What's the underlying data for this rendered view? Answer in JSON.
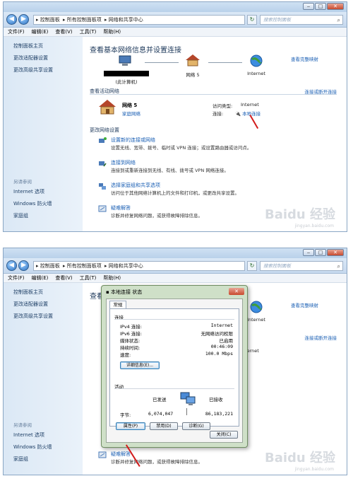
{
  "window": {
    "caption": {
      "minimize": "‒",
      "maximize": "□",
      "close": "✕"
    },
    "nav": {
      "back": "◀",
      "forward": "▶"
    },
    "breadcrumb": [
      "控制面板",
      "所有控制面板项",
      "网络和共享中心"
    ],
    "search_placeholder": "搜索控制面板",
    "menu": [
      "文件(F)",
      "编辑(E)",
      "查看(V)",
      "工具(T)",
      "帮助(H)"
    ]
  },
  "sidebar": {
    "items": [
      "控制面板主页",
      "更改适配器设置",
      "更改高级共享设置"
    ],
    "see_also_label": "另请参阅",
    "see_also": [
      "Internet 选项",
      "Windows 防火墙",
      "家庭组"
    ]
  },
  "main": {
    "title": "查看基本网络信息并设置连接",
    "view_full_map": "查看完整映射",
    "map": {
      "computer": "(此计算机)",
      "network": "网络  5",
      "internet": "Internet"
    },
    "active_label": "查看活动网络",
    "connect_disconnect": "连接或断开连接",
    "network_name": "网络  5",
    "network_type": "家庭网络",
    "access_type_label": "访问类型:",
    "access_type_value": "Internet",
    "connection_label": "连接:",
    "connection_value": "本地连接",
    "change_label": "更改网络设置",
    "tasks": [
      {
        "title": "设置新的连接或网络",
        "desc": "设置无线、宽带、拨号、临时或 VPN 连接；或设置路由器或访问点。"
      },
      {
        "title": "连接到网络",
        "desc": "连接到或重新连接到无线、有线、拨号或 VPN 网络连接。"
      },
      {
        "title": "选择家庭组和共享选项",
        "desc": "访问位于其他网络计算机上的文件和打印机，或更改共享设置。"
      },
      {
        "title": "疑难解答",
        "desc": "诊断并修复网络问题，或获得故障排除信息。"
      }
    ]
  },
  "watermark": {
    "brand": "Baidu 经验",
    "sub": "jingyan.baidu.com"
  },
  "dialog": {
    "title": "本地连接 状态",
    "tab": "常规",
    "connection_group": "连接",
    "rows": [
      {
        "label": "IPv4 连接:",
        "value": "Internet"
      },
      {
        "label": "IPv6 连接:",
        "value": "无网络访问权限"
      },
      {
        "label": "媒体状态:",
        "value": "已启用"
      },
      {
        "label": "持续时间:",
        "value": "00:46:09"
      },
      {
        "label": "速度:",
        "value": "100.0 Mbps"
      }
    ],
    "details_button": "详细信息(E)...",
    "activity_group": "活动",
    "sent_label": "已发送",
    "received_label": "已接收",
    "bytes_label": "字节:",
    "bytes_sent": "6,074,047",
    "bytes_received": "86,183,221",
    "properties_button": "属性(P)",
    "disable_button": "禁用(D)",
    "diagnose_button": "诊断(G)",
    "close_button": "关闭(C)"
  },
  "colors": {
    "accent": "#1a5fb4",
    "annotation": "#d21b1b",
    "dialog_frame": "#cfe0c8"
  }
}
